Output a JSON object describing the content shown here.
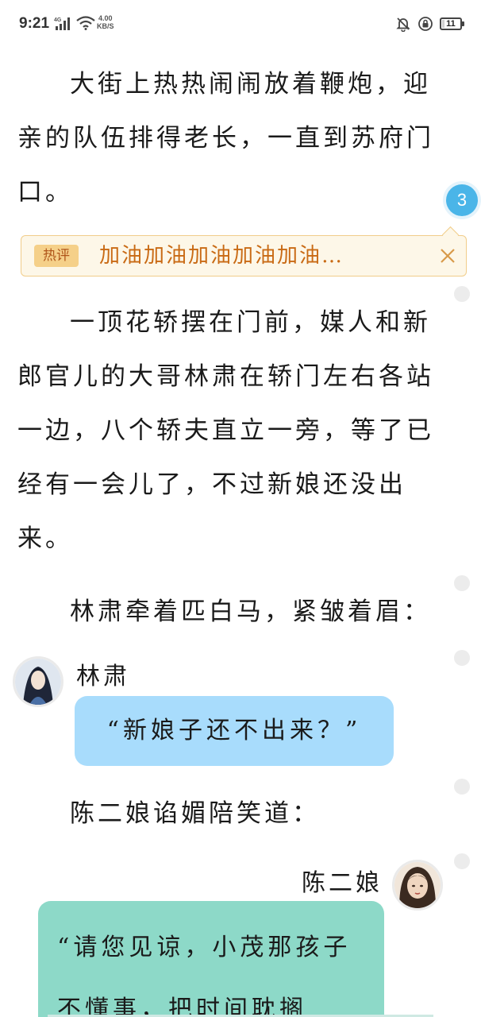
{
  "status_bar": {
    "time": "9:21",
    "network": "4G",
    "net_speed_value": "4.00",
    "net_speed_unit": "KB/S",
    "battery": "11"
  },
  "paragraphs": [
    "大街上热热闹闹放着鞭炮，迎亲的队伍排得老长，一直到苏府门口。",
    "一顶花轿摆在门前，媒人和新郎官儿的大哥林肃在轿门左右各站一边，八个轿夫直立一旁，等了已经有一会儿了，不过新娘还没出来。",
    "林肃牵着匹白马，紧皱着眉：",
    "陈二娘谄媚陪笑道："
  ],
  "comment_count": "3",
  "hot_comment": {
    "tag": "热评",
    "text": "加油加油加油加油加油…"
  },
  "chat": [
    {
      "speaker": "林肃",
      "text": "“新娘子还不出来？”",
      "side": "left",
      "color": "#a8dcfc"
    },
    {
      "speaker": "陈二娘",
      "text": "“请您见谅，小茂那孩子不懂事，把时间耽搁",
      "side": "right",
      "color": "#8dd9c8"
    }
  ]
}
